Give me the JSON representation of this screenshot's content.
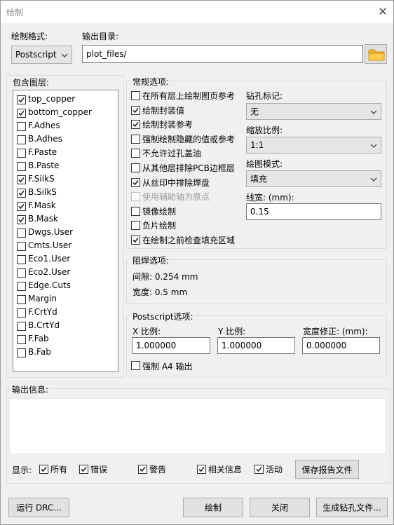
{
  "window": {
    "title": "绘制"
  },
  "format": {
    "label": "绘制格式:",
    "value": "Postscript"
  },
  "output_dir": {
    "label": "输出目录:",
    "value": "plot_files/"
  },
  "layers": {
    "label": "包含图层:",
    "items": [
      {
        "name": "top_copper",
        "checked": true
      },
      {
        "name": "bottom_copper",
        "checked": true
      },
      {
        "name": "F.Adhes",
        "checked": false
      },
      {
        "name": "B.Adhes",
        "checked": false
      },
      {
        "name": "F.Paste",
        "checked": false
      },
      {
        "name": "B.Paste",
        "checked": false
      },
      {
        "name": "F.SilkS",
        "checked": true
      },
      {
        "name": "B.SilkS",
        "checked": true
      },
      {
        "name": "F.Mask",
        "checked": true
      },
      {
        "name": "B.Mask",
        "checked": true
      },
      {
        "name": "Dwgs.User",
        "checked": false
      },
      {
        "name": "Cmts.User",
        "checked": false
      },
      {
        "name": "Eco1.User",
        "checked": false
      },
      {
        "name": "Eco2.User",
        "checked": false
      },
      {
        "name": "Edge.Cuts",
        "checked": false
      },
      {
        "name": "Margin",
        "checked": false
      },
      {
        "name": "F.CrtYd",
        "checked": false
      },
      {
        "name": "B.CrtYd",
        "checked": false
      },
      {
        "name": "F.Fab",
        "checked": false
      },
      {
        "name": "B.Fab",
        "checked": false
      }
    ]
  },
  "general": {
    "label": "常规选项:",
    "options": [
      {
        "label": "在所有层上绘制图页参考",
        "checked": false,
        "disabled": false
      },
      {
        "label": "绘制封装值",
        "checked": true,
        "disabled": false
      },
      {
        "label": "绘制封装参考",
        "checked": true,
        "disabled": false
      },
      {
        "label": "强制绘制隐藏的值或参考",
        "checked": false,
        "disabled": false
      },
      {
        "label": "不允许过孔盖油",
        "checked": false,
        "disabled": false
      },
      {
        "label": "从其他层排除PCB边框层",
        "checked": false,
        "disabled": false
      },
      {
        "label": "从丝印中排除焊盘",
        "checked": true,
        "disabled": false
      },
      {
        "label": "使用辅助轴为原点",
        "checked": false,
        "disabled": true
      },
      {
        "label": "镜像绘制",
        "checked": false,
        "disabled": false
      },
      {
        "label": "负片绘制",
        "checked": false,
        "disabled": false
      },
      {
        "label": "在绘制之前检查填充区域",
        "checked": true,
        "disabled": false
      }
    ],
    "drill_marks": {
      "label": "钻孔标记:",
      "value": "无"
    },
    "scale": {
      "label": "缩放比例:",
      "value": "1:1"
    },
    "plot_mode": {
      "label": "绘图模式:",
      "value": "填充"
    },
    "line_width": {
      "label": "线宽:  (mm):",
      "value": "0.15"
    }
  },
  "mask": {
    "label": "阻焊选项:",
    "clearance": "间隙:  0.254 mm",
    "width": "宽度:  0.5 mm"
  },
  "postscript": {
    "label": "Postscript选项:",
    "x_scale": {
      "label": "X 比例:",
      "value": "1.000000"
    },
    "y_scale": {
      "label": "Y 比例:",
      "value": "1.000000"
    },
    "width_adj": {
      "label": "宽度修正: (mm):",
      "value": "0.000000"
    },
    "force_a4": {
      "label": "强制 A4 输出",
      "checked": false
    }
  },
  "messages": {
    "label": "输出信息:",
    "show_label": "显示:",
    "filters": [
      {
        "label": "所有",
        "checked": true
      },
      {
        "label": "错误",
        "checked": true
      },
      {
        "label": "警告",
        "checked": true
      },
      {
        "label": "相关信息",
        "checked": true
      },
      {
        "label": "活动",
        "checked": true
      }
    ],
    "save_report": "保存报告文件"
  },
  "buttons": {
    "run_drc": "运行 DRC...",
    "plot": "绘制",
    "close": "关闭",
    "gen_drill": "生成钻孔文件..."
  }
}
